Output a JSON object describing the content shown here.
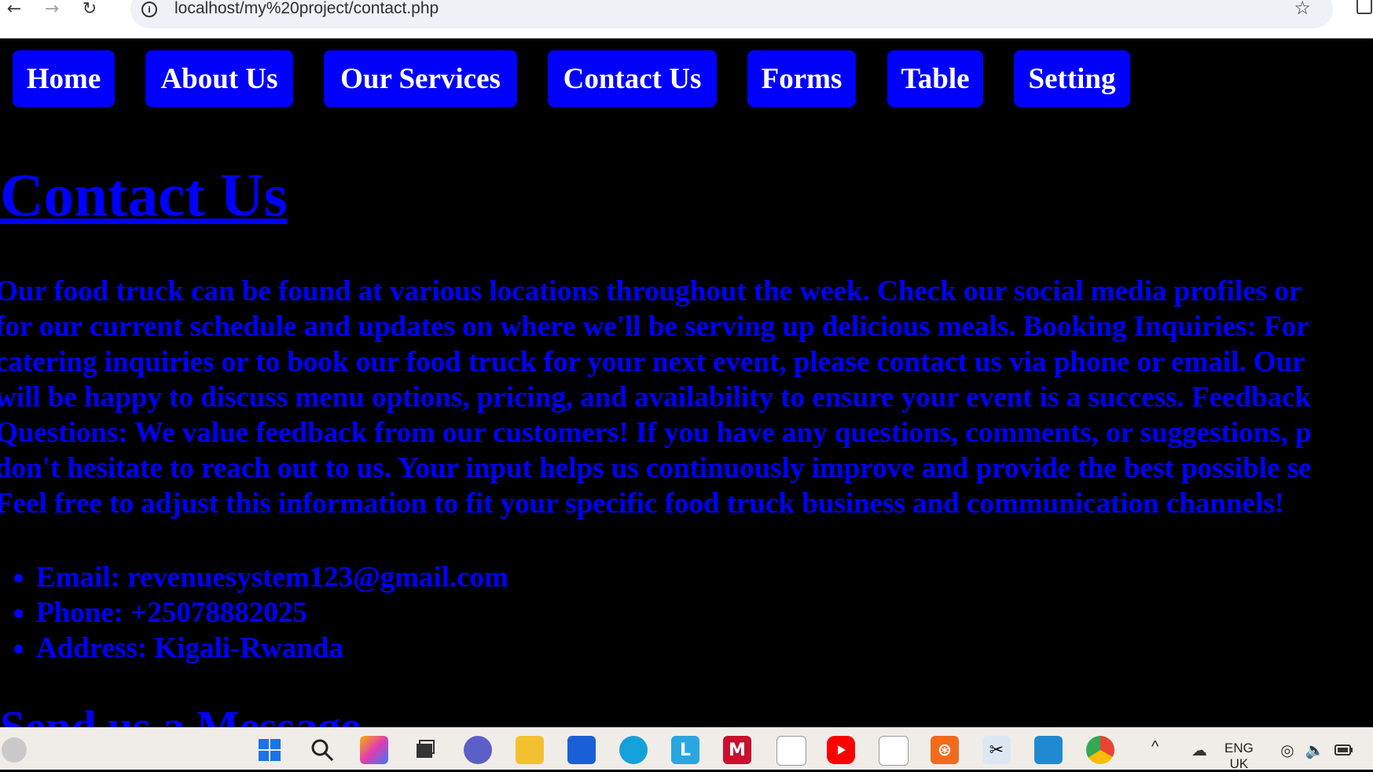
{
  "browser": {
    "url": "localhost/my%20project/contact.php",
    "back_icon": "←",
    "forward_icon": "→",
    "reload_icon": "↻",
    "info_icon": "i",
    "star_icon": "☆"
  },
  "nav": {
    "items": [
      {
        "label": "Home"
      },
      {
        "label": "About Us"
      },
      {
        "label": "Our Services"
      },
      {
        "label": "Contact Us"
      },
      {
        "label": "Forms"
      },
      {
        "label": "Table"
      },
      {
        "label": "Setting"
      }
    ]
  },
  "main": {
    "title": "Contact Us",
    "intro_lines": [
      "Our food truck can be found at various locations throughout the week. Check our social media profiles or",
      "for our current schedule and updates on where we'll be serving up delicious meals. Booking Inquiries: For",
      "catering inquiries or to book our food truck for your next event, please contact us via phone or email. Our",
      "will be happy to discuss menu options, pricing, and availability to ensure your event is a success. Feedback",
      "Questions: We value feedback from our customers! If you have any questions, comments, or suggestions, p",
      "don't hesitate to reach out to us. Your input helps us continuously improve and provide the best possible se",
      "Feel free to adjust this information to fit your specific food truck business and communication channels!"
    ],
    "contacts": [
      "Email: revenuesystem123@gmail.com",
      "Phone: +25078882025",
      "Address: Kigali-Rwanda"
    ],
    "next_heading": "Send us a Message"
  },
  "taskbar": {
    "language": "ENG",
    "region": "UK",
    "colors": {
      "accent": "#0000ff",
      "page_bg": "#000000",
      "nav_text": "#ffffff"
    }
  }
}
